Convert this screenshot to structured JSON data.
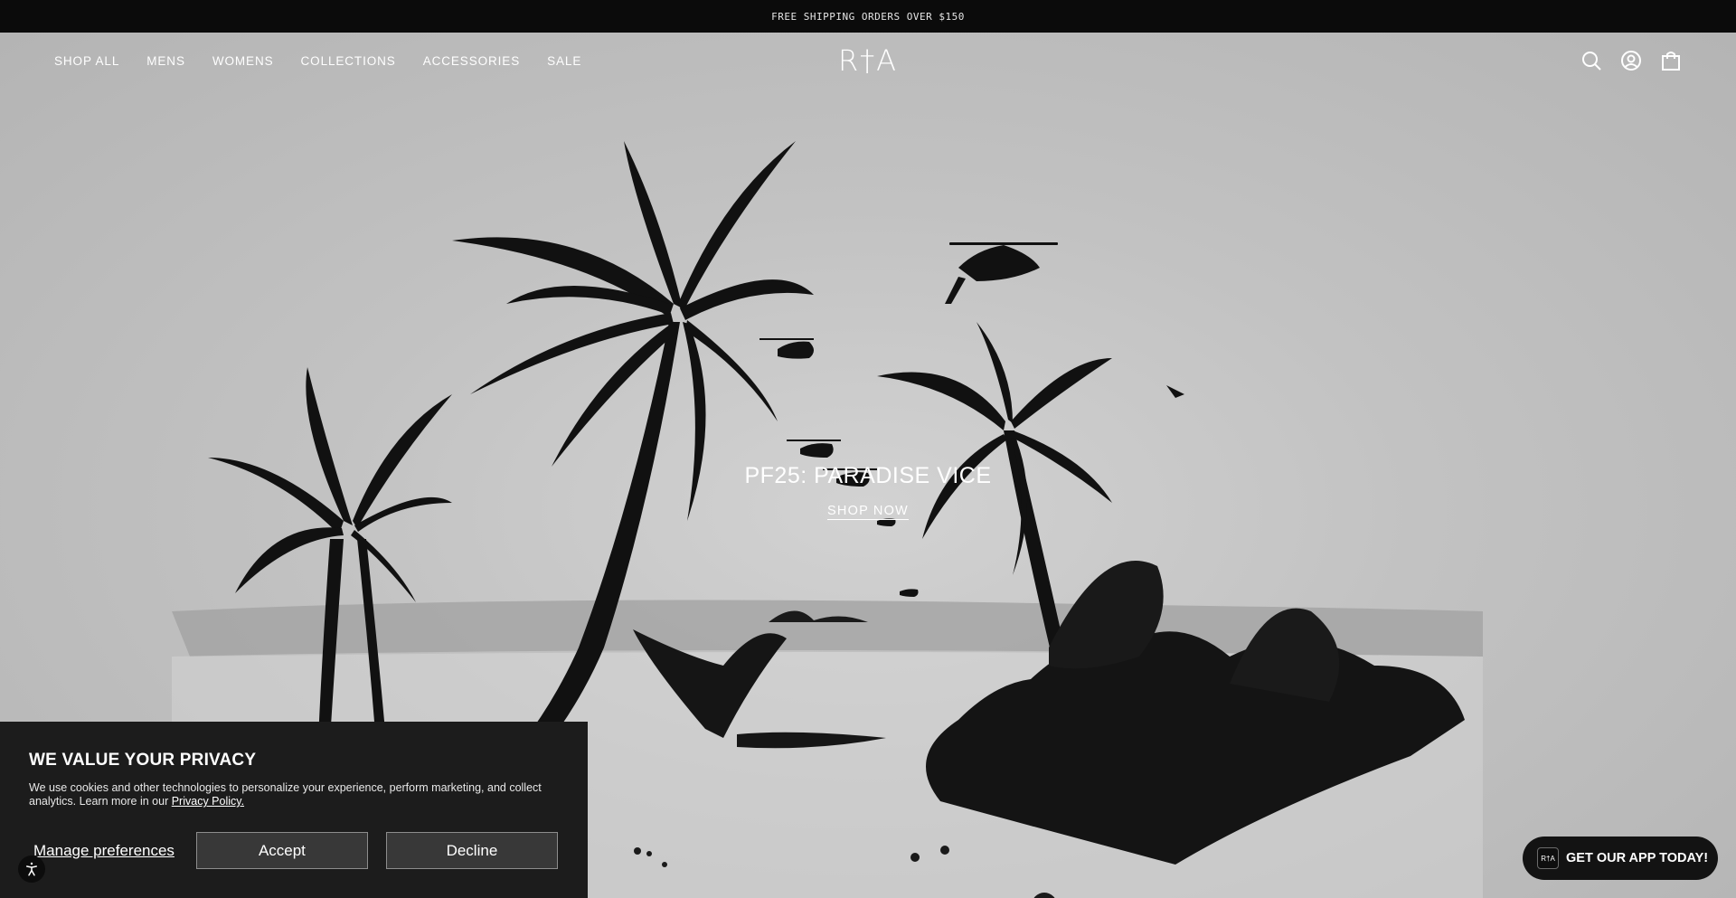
{
  "announcement": {
    "text": "FREE SHIPPING ORDERS OVER $150"
  },
  "header": {
    "nav": [
      "SHOP ALL",
      "MENS",
      "WOMENS",
      "COLLECTIONS",
      "ACCESSORIES",
      "SALE"
    ],
    "logo": "R†A",
    "icons": [
      "search-icon",
      "account-icon",
      "bag-icon"
    ]
  },
  "hero": {
    "title": "PF25: PARADISE VICE",
    "cta": "SHOP NOW"
  },
  "privacy": {
    "title": "WE VALUE YOUR PRIVACY",
    "body": "We use cookies and other technologies to personalize your experience, perform marketing, and collect analytics. Learn more in our ",
    "link": "Privacy Policy.",
    "manage": "Manage preferences",
    "accept": "Accept",
    "decline": "Decline"
  },
  "app_button": {
    "logo": "R†A",
    "label": "GET OUR APP TODAY!"
  },
  "colors": {
    "announcement_bg": "#0b0b0b",
    "panel_bg": "#1c1c1c",
    "button_bg": "#383838"
  }
}
